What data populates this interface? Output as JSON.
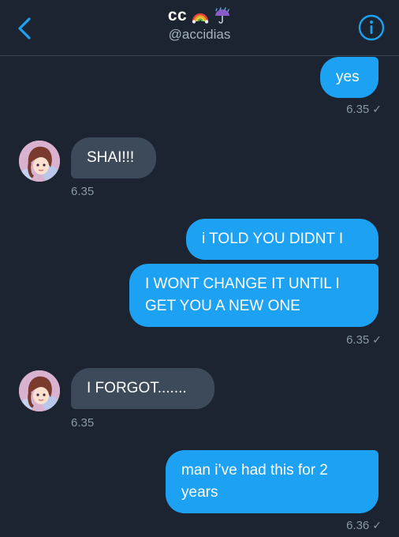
{
  "header": {
    "name": "cc",
    "emojis": [
      "rainbow-icon",
      "umbrella-rain-icon"
    ],
    "handle": "@accidias"
  },
  "messages": [
    {
      "from": "me",
      "text": "yes"
    },
    {
      "time": "6.35",
      "status": "✓"
    },
    {
      "from": "them",
      "text": "SHAI!!!"
    },
    {
      "time": "6.35"
    },
    {
      "from": "me",
      "text": "i TOLD YOU DIDNT I"
    },
    {
      "from": "me",
      "text": "I WONT CHANGE IT UNTIL I GET YOU A NEW ONE"
    },
    {
      "time": "6.35",
      "status": "✓"
    },
    {
      "from": "them",
      "text": "I FORGOT......."
    },
    {
      "time": "6.35"
    },
    {
      "from": "me",
      "text": "man i’ve had this for 2 years"
    },
    {
      "time": "6.36",
      "status": "✓"
    }
  ],
  "colors": {
    "background": "#1b2430",
    "outgoing": "#1da1f2",
    "incoming": "#3d4a59",
    "accent": "#1da1f2",
    "muted": "#8899a6"
  }
}
